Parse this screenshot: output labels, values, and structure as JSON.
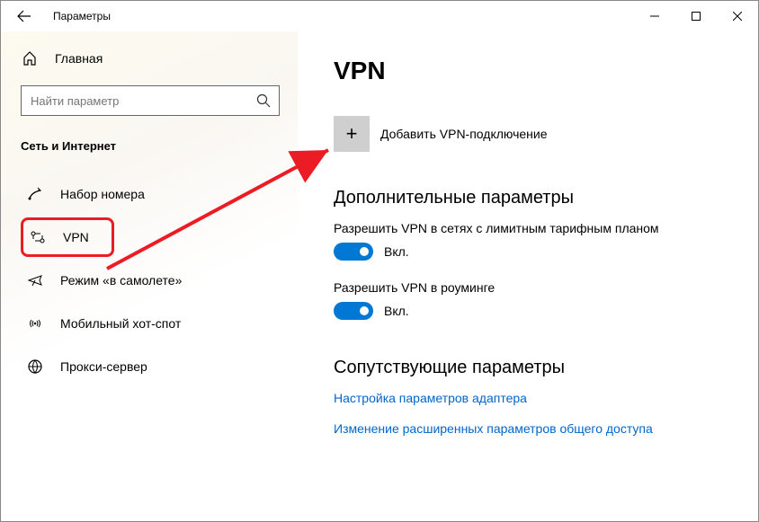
{
  "titlebar": {
    "title": "Параметры"
  },
  "sidebar": {
    "home": "Главная",
    "search_placeholder": "Найти параметр",
    "section": "Сеть и Интернет",
    "items": [
      {
        "label": "Набор номера"
      },
      {
        "label": "VPN"
      },
      {
        "label": "Режим «в самолете»"
      },
      {
        "label": "Мобильный хот-спот"
      },
      {
        "label": "Прокси-сервер"
      }
    ]
  },
  "content": {
    "heading": "VPN",
    "add_label": "Добавить VPN-подключение",
    "advanced_heading": "Дополнительные параметры",
    "setting1_label": "Разрешить VPN в сетях с лимитным тарифным планом",
    "setting2_label": "Разрешить VPN в роуминге",
    "toggle_on": "Вкл.",
    "related_heading": "Сопутствующие параметры",
    "link1": "Настройка параметров адаптера",
    "link2": "Изменение расширенных параметров общего доступа"
  }
}
